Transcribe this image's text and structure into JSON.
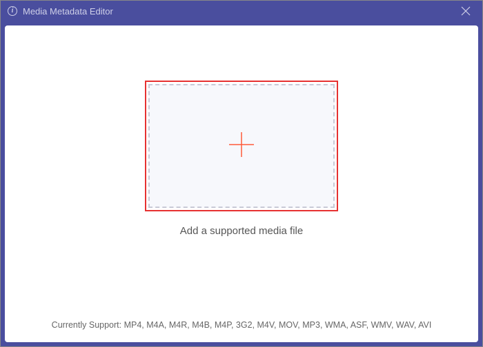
{
  "titlebar": {
    "title": "Media Metadata Editor"
  },
  "main": {
    "instruction": "Add a supported media file"
  },
  "footer": {
    "support_text": "Currently Support: MP4, M4A, M4R, M4B, M4P, 3G2, M4V, MOV, MP3, WMA, ASF, WMV, WAV, AVI"
  }
}
